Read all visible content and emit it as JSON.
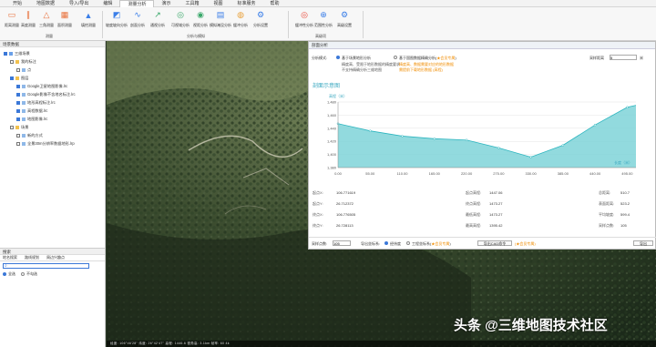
{
  "menu": {
    "items": [
      "开始",
      "地图数据",
      "导入/导出",
      "编辑",
      "测量分析",
      "演示",
      "工具箱",
      "视图",
      "标准服务",
      "帮助"
    ],
    "active_index": 4
  },
  "ribbon": {
    "buttons": [
      {
        "label": "距离测量",
        "icon": "ruler-icon"
      },
      {
        "label": "高度测量",
        "icon": "height-icon"
      },
      {
        "label": "三角测量",
        "icon": "triangle-icon"
      },
      {
        "label": "面积测量",
        "icon": "area-icon"
      },
      {
        "label": "填挖测量",
        "icon": "cutfill-icon"
      },
      {
        "label": "坡度坡向分析",
        "icon": "slope-icon"
      },
      {
        "label": "剖面分析",
        "icon": "profile-icon"
      },
      {
        "label": "通视分析",
        "icon": "sightline-icon"
      },
      {
        "label": "可视域分析",
        "icon": "viewshed-icon"
      },
      {
        "label": "视距分析",
        "icon": "visibility-icon"
      },
      {
        "label": "模拟淹没分析",
        "icon": "flood-icon"
      },
      {
        "label": "缓冲分析",
        "icon": "buffer-icon"
      },
      {
        "label": "分析设置",
        "icon": "gear-icon"
      },
      {
        "label": "缓冲性分析",
        "icon": "target-icon"
      },
      {
        "label": "范围性分析",
        "icon": "range-icon"
      },
      {
        "label": "高级设置",
        "icon": "settings-icon"
      }
    ],
    "groups": {
      "measure": "测量",
      "analysis": "分析与模拟",
      "advanced": "高级项"
    }
  },
  "left_panel": {
    "title": "场景数据",
    "tree": [
      {
        "label": "三维场景",
        "level": 0,
        "checked": true
      },
      {
        "label": "我的标注",
        "level": 1,
        "checked": false
      },
      {
        "label": "点",
        "level": 2,
        "checked": false
      },
      {
        "label": "图层",
        "level": 1,
        "checked": true
      },
      {
        "label": "Google卫星地图影像.lrc",
        "level": 2,
        "checked": true
      },
      {
        "label": "Google影像不含地名标注.lrc",
        "level": 2,
        "checked": true
      },
      {
        "label": "地形高程标注.lrc",
        "level": 2,
        "checked": true
      },
      {
        "label": "高程数据.lrc",
        "level": 2,
        "checked": true
      },
      {
        "label": "地图影像.lrc",
        "level": 2,
        "checked": true
      },
      {
        "label": "场景",
        "level": 1,
        "checked": false
      },
      {
        "label": "新的方式",
        "level": 2,
        "checked": false
      },
      {
        "label": "全景30m分辨率数据地形.lrp",
        "level": 2,
        "checked": false
      }
    ],
    "search_title": "搜索",
    "search_tabs": [
      "地名搜索",
      "路线规划",
      "周边兴趣点"
    ],
    "search_placeholder": "",
    "search_options": [
      "全选",
      "不勾选"
    ]
  },
  "profile_panel": {
    "title": "剖面分析",
    "mode_label": "分析模式:",
    "mode1": "基于场景地形分析",
    "mode1_note1": "精度高、受限于地形数据的精度要求",
    "mode1_note2": "不支持精确分析三维地图",
    "mode2": "基于国图数据精确分析(",
    "mode2_vip": "★会员专属",
    "mode2_close": ")",
    "mode2_note1": "精度高、数据需要对应的地形数据",
    "mode2_note2": "需提前下载地形数据 (高程)",
    "sample_label": "采样距离",
    "sample_value": "5",
    "sample_unit": "米",
    "chart_title": "剖面示意图",
    "stats": [
      {
        "label": "起点X:",
        "value": "106.771619"
      },
      {
        "label": "起点Y:",
        "value": "26.712372"
      },
      {
        "label": "终点X:",
        "value": "106.776505"
      },
      {
        "label": "终点Y:",
        "value": "26.728113"
      }
    ],
    "stats2": [
      {
        "label": "起点高程:",
        "value": "1447.06"
      },
      {
        "label": "终点高程:",
        "value": "1473.27"
      },
      {
        "label": "最低高程:",
        "value": "1473.27"
      },
      {
        "label": "最高高程:",
        "value": "1395.42"
      }
    ],
    "stats3": [
      {
        "label": "总距离:",
        "value": "510.7"
      },
      {
        "label": "表面距离:",
        "value": "523.2"
      },
      {
        "label": "平均坡度:",
        "value": "599.4"
      },
      {
        "label": "采样点数:",
        "value": "105"
      }
    ],
    "bottom": {
      "sample_spacing_label": "采样点数:",
      "sample_spacing_value": "105",
      "export_label": "导出坐标系:",
      "export_opt1": "经纬度",
      "export_opt2": "工程坐标系(",
      "export_vip": "★会员专属",
      "export_close": ")",
      "cad_button": "导出CAD命令",
      "vip_note": "(★会员专属)",
      "export_button": "导出"
    }
  },
  "chart_data": {
    "type": "area",
    "title": "剖面示意图",
    "ylabel": "高程（米）",
    "xlabel": "长度（米）",
    "x": [
      0,
      55,
      110,
      165,
      220,
      275,
      330,
      385,
      440,
      495
    ],
    "x_ticks": [
      "0.00",
      "55.00",
      "110.00",
      "165.00",
      "220.00",
      "275.00",
      "330.00",
      "385.00",
      "440.00",
      "495.00"
    ],
    "y_ticks": [
      "1,380",
      "1,400",
      "1,420",
      "1,440",
      "1,460",
      "1,480"
    ],
    "ylim": [
      1380,
      1480
    ],
    "xlim": [
      0,
      510
    ],
    "points": [
      {
        "x": 0,
        "y": 1447
      },
      {
        "x": 55,
        "y": 1436
      },
      {
        "x": 110,
        "y": 1428
      },
      {
        "x": 165,
        "y": 1424
      },
      {
        "x": 220,
        "y": 1422
      },
      {
        "x": 275,
        "y": 1410
      },
      {
        "x": 330,
        "y": 1396
      },
      {
        "x": 385,
        "y": 1414
      },
      {
        "x": 440,
        "y": 1445
      },
      {
        "x": 495,
        "y": 1472
      },
      {
        "x": 510,
        "y": 1475
      }
    ],
    "fill_color": "#7fd4d8",
    "line_color": "#2cb5bf"
  },
  "statusbar": {
    "text": "经度: 106°46'28\"  纬度: 26°42'47\"  高程: 1446.6  视角高: 3.1km  帧率: 60  4k"
  },
  "watermark": {
    "text": "头条 @三维地图技术社区"
  },
  "colors": {
    "accent": "#3b78d8",
    "vip": "#f08c00",
    "chart_fill": "#7fd4d8",
    "chart_line": "#2cb5bf"
  }
}
